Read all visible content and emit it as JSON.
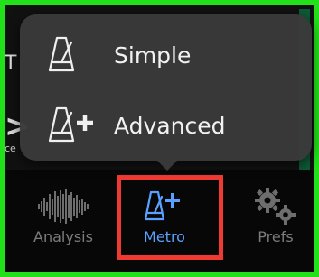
{
  "background": {
    "fragment_top": "T",
    "fragment_mid": ">",
    "fragment_text": "ce"
  },
  "popover": {
    "items": [
      {
        "label": "Simple",
        "icon": "metronome-icon"
      },
      {
        "label": "Advanced",
        "icon": "metronome-plus-icon"
      }
    ]
  },
  "tabbar": {
    "tabs": [
      {
        "label": "Analysis",
        "icon": "waveform-icon",
        "selected": false
      },
      {
        "label": "Metro",
        "icon": "metronome-plus-icon",
        "selected": true
      },
      {
        "label": "Prefs",
        "icon": "gears-icon",
        "selected": false
      }
    ]
  },
  "colors": {
    "frame": "#22e01a",
    "highlight": "#ef3a32",
    "selected_tab": "#5aa1ff",
    "unselected_tab": "#7c7c7c",
    "popover_bg": "#3a3a3a"
  }
}
